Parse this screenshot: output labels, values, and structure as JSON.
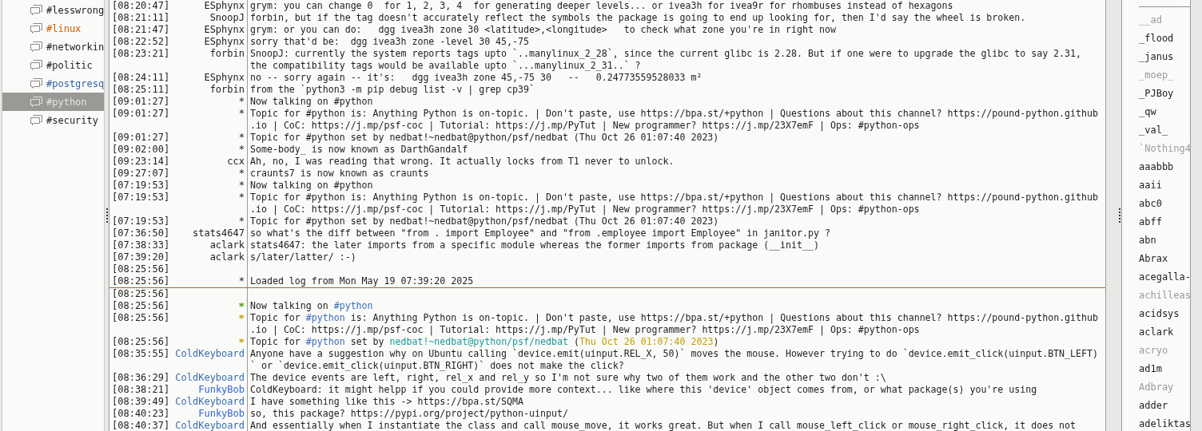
{
  "channels": [
    {
      "name": "#lesswrong",
      "highlighted": false,
      "new_data": false,
      "selected": false
    },
    {
      "name": "#linux",
      "highlighted": true,
      "new_data": false,
      "selected": false
    },
    {
      "name": "#networkin",
      "highlighted": false,
      "new_data": false,
      "selected": false
    },
    {
      "name": "#politic",
      "highlighted": false,
      "new_data": false,
      "selected": false
    },
    {
      "name": "#postgresq",
      "highlighted": false,
      "new_data": true,
      "selected": false
    },
    {
      "name": "#python",
      "highlighted": false,
      "new_data": false,
      "selected": true
    },
    {
      "name": "#security",
      "highlighted": false,
      "new_data": false,
      "selected": false
    }
  ],
  "messages": [
    {
      "kind": "message",
      "time": "[08:20:47]",
      "nick": "ESphynx",
      "lines": [
        "grym: you can change 0  for 1, 2, 3, 4  for generating deeper levels... or ivea3h for ivea9r for rhombuses instead of hexagons"
      ]
    },
    {
      "kind": "message",
      "time": "[08:21:11]",
      "nick": "SnoopJ",
      "lines": [
        "forbin, but if the tag doesn't accurately reflect the symbols the package is going to end up looking for, then I'd say the wheel is broken."
      ]
    },
    {
      "kind": "message",
      "time": "[08:21:47]",
      "nick": "ESphynx",
      "lines": [
        "grym: or you can do:   dgg ivea3h zone 30 <latitude>,<longitude>   to check what zone you're in right now"
      ]
    },
    {
      "kind": "message",
      "time": "[08:22:52]",
      "nick": "ESphynx",
      "lines": [
        "sorry that'd be:  dgg ivea3h zone -level 30 45,-75"
      ]
    },
    {
      "kind": "message",
      "time": "[08:23:21]",
      "nick": "forbin",
      "lines": [
        "SnoopJ: currently the system reports tags upto `..manylinux_2_28`, since the current glibc is 2.28. But if one were to upgrade the glibc to say 2.31,",
        "the compatibility tags would be available upto `...manylinux_2_31..` ?"
      ]
    },
    {
      "kind": "message",
      "time": "[08:24:11]",
      "nick": "ESphynx",
      "lines": [
        "no -- sorry again -- it's:   dgg ivea3h zone 45,-75 30   --   0.24773559528033 m²"
      ]
    },
    {
      "kind": "message",
      "time": "[08:25:11]",
      "nick": "forbin",
      "lines": [
        "from the `python3 -m pip debug list -v | grep cp39`"
      ]
    },
    {
      "kind": "message",
      "time": "[09:01:27]",
      "nick": "*",
      "lines": [
        "Now talking on #python"
      ]
    },
    {
      "kind": "message",
      "time": "[09:01:27]",
      "nick": "*",
      "lines": [
        "Topic for #python is: Anything Python is on-topic. | Don't paste, use https://bpa.st/+python | Questions about this channel? https://pound-python.github",
        ".io | CoC: https://j.mp/psf-coc | Tutorial: https://j.mp/PyTut | New programmer? https://j.mp/23X7emF | Ops: #python-ops"
      ]
    },
    {
      "kind": "message",
      "time": "[09:01:27]",
      "nick": "*",
      "lines": [
        "Topic for #python set by nedbat!~nedbat@python/psf/nedbat (Thu Oct 26 01:07:40 2023)"
      ]
    },
    {
      "kind": "message",
      "time": "[09:02:00]",
      "nick": "*",
      "lines": [
        "Some-body_ is now known as DarthGandalf"
      ]
    },
    {
      "kind": "message",
      "time": "[09:23:14]",
      "nick": "ccx",
      "lines": [
        "Ah, no, I was reading that wrong. It actually locks from T1 never to unlock."
      ]
    },
    {
      "kind": "message",
      "time": "[09:27:07]",
      "nick": "*",
      "lines": [
        "craunts7 is now known as craunts"
      ]
    },
    {
      "kind": "message",
      "time": "[07:19:53]",
      "nick": "*",
      "lines": [
        "Now talking on #python"
      ]
    },
    {
      "kind": "message",
      "time": "[07:19:53]",
      "nick": "*",
      "lines": [
        "Topic for #python is: Anything Python is on-topic. | Don't paste, use https://bpa.st/+python | Questions about this channel? https://pound-python.github",
        ".io | CoC: https://j.mp/psf-coc | Tutorial: https://j.mp/PyTut | New programmer? https://j.mp/23X7emF | Ops: #python-ops"
      ]
    },
    {
      "kind": "message",
      "time": "[07:19:53]",
      "nick": "*",
      "lines": [
        "Topic for #python set by nedbat!~nedbat@python/psf/nedbat (Thu Oct 26 01:07:40 2023)"
      ]
    },
    {
      "kind": "message",
      "time": "[07:36:50]",
      "nick": "stats4647",
      "lines": [
        "so what's the diff between \"from . import Employee\" and \"from .employee import Employee\" in janitor.py ?"
      ]
    },
    {
      "kind": "message",
      "time": "[07:38:33]",
      "nick": "aclark",
      "lines": [
        "stats4647: the later imports from a specific module whereas the former imports from package (__init__)"
      ]
    },
    {
      "kind": "message",
      "time": "[07:39:20]",
      "nick": "aclark",
      "lines": [
        "s/later/latter/ :-)"
      ]
    },
    {
      "kind": "message",
      "time": "[08:25:56]"
    },
    {
      "kind": "message",
      "time": "[08:25:56]",
      "nick": "*",
      "lines": [
        "Loaded log from Mon May 19 07:39:20 2025"
      ]
    },
    {
      "kind": "marker"
    },
    {
      "kind": "message",
      "time": "[08:25:56]"
    },
    {
      "kind": "message",
      "time": "[08:25:56]",
      "nick": "*",
      "color": "#4e9a06",
      "lines": [
        [
          "Now talking on ",
          {
            "kind": "channel",
            "text": "#python"
          }
        ]
      ]
    },
    {
      "kind": "message",
      "time": "[08:25:56]",
      "nick": "*",
      "color": "#c4a000",
      "lines": [
        [
          "Topic for ",
          {
            "kind": "channel",
            "text": "#python"
          },
          " is: Anything Python is on-topic. | Don't paste, use https://bpa.st/+python | Questions about this channel? https://pound-python.github"
        ],
        ".io | CoC: https://j.mp/psf-coc | Tutorial: https://j.mp/PyTut | New programmer? https://j.mp/23X7emF | Ops: #python-ops"
      ]
    },
    {
      "kind": "message",
      "time": "[08:25:56]",
      "nick": "*",
      "color": "#c4a000",
      "lines": [
        [
          "Topic for ",
          {
            "kind": "channel",
            "text": "#python"
          },
          " set by ",
          {
            "kind": "nick",
            "text": "nedbat!~nedbat@python/psf/nedbat"
          },
          " (",
          {
            "kind": "date",
            "text": "Thu Oct 26 01:07:40 2023"
          },
          ")"
        ]
      ]
    },
    {
      "kind": "message",
      "time": "[08:35:55]",
      "nick": "ColdKeyboard",
      "color": "#3a6eb0",
      "lines": [
        "Anyone have a suggestion why on Ubuntu calling `device.emit(uinput.REL_X, 50)` moves the mouse. However trying to do `device.emit_click(uinput.BTN_LEFT)",
        "` or `device.emit_click(uinput.BTN_RIGHT)` does not make the click?"
      ]
    },
    {
      "kind": "message",
      "time": "[08:36:29]",
      "nick": "ColdKeyboard",
      "color": "#3a6eb0",
      "lines": [
        "The device events are left, right, rel_x and rel_y so I'm not sure why two of them work and the other two don't :\\"
      ]
    },
    {
      "kind": "message",
      "time": "[08:38:21]",
      "nick": "FunkyBob",
      "color": "#3465d4",
      "lines": [
        "ColdKeyboard: it might helpp if you could provide more context... like where this 'device' object comes from, or what package(s) you're using"
      ]
    },
    {
      "kind": "message",
      "time": "[08:39:49]",
      "nick": "ColdKeyboard",
      "color": "#3a6eb0",
      "lines": [
        "I have something like this -> https://bpa.st/SQMA"
      ]
    },
    {
      "kind": "message",
      "time": "[08:40:23]",
      "nick": "FunkyBob",
      "color": "#3465d4",
      "lines": [
        "so, this package? https://pypi.org/project/python-uinput/"
      ]
    },
    {
      "kind": "message",
      "time": "[08:40:37]",
      "nick": "ColdKeyboard",
      "color": "#3a6eb0",
      "lines": [
        "And essentially when I instantiate the class and call mouse_move, it works great. But when I call mouse_left_click or mouse_right_click, it does not"
      ]
    }
  ],
  "users": [
    {
      "name": "_________",
      "away": false
    },
    {
      "name": "__ad",
      "away": true
    },
    {
      "name": "_flood",
      "away": false
    },
    {
      "name": "_janus",
      "away": false
    },
    {
      "name": "_moep_",
      "away": true
    },
    {
      "name": "_PJBoy",
      "away": false
    },
    {
      "name": "_qw",
      "away": false
    },
    {
      "name": "_val_",
      "away": false
    },
    {
      "name": "`Nothing4",
      "away": true
    },
    {
      "name": "aaabbb",
      "away": false
    },
    {
      "name": "aaii",
      "away": false
    },
    {
      "name": "abc0",
      "away": false
    },
    {
      "name": "abff",
      "away": false
    },
    {
      "name": "abn",
      "away": false
    },
    {
      "name": "Abrax",
      "away": false
    },
    {
      "name": "acegalla-",
      "away": false
    },
    {
      "name": "achilleas",
      "away": true
    },
    {
      "name": "acidsys",
      "away": false
    },
    {
      "name": "aclark",
      "away": false
    },
    {
      "name": "acryo",
      "away": true
    },
    {
      "name": "ad1m",
      "away": false
    },
    {
      "name": "Adbray",
      "away": true
    },
    {
      "name": "adder",
      "away": false
    },
    {
      "name": "adeliktas",
      "away": false
    }
  ]
}
